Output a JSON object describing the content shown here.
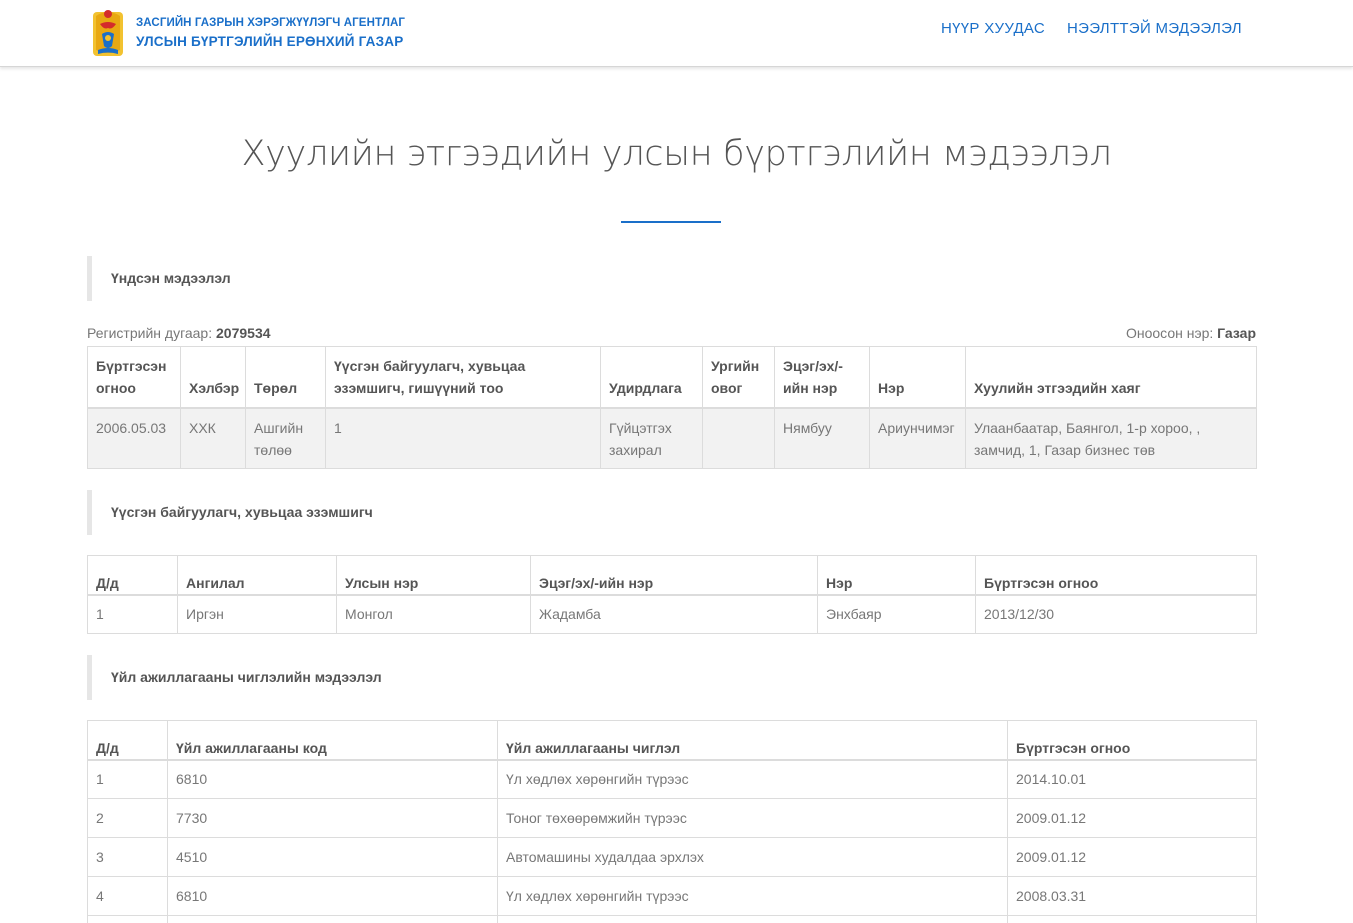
{
  "header": {
    "agency_line1": "ЗАСГИЙН ГАЗРЫН ХЭРЭГЖҮҮЛЭГЧ АГЕНТЛАГ",
    "agency_line2": "УЛСЫН БҮРТГЭЛИЙН ЕРӨНХИЙ ГАЗАР",
    "nav_home": "НҮҮР ХУУДАС",
    "nav_contact": "НЭЭЛТТЭЙ МЭДЭЭЛЭЛ",
    "accent": "#1a6fc9",
    "logo_icon": "state-emblem-icon"
  },
  "page_title": "Хуулийн этгээдийн улсын бүртгэлийн мэдээлэл",
  "basic": {
    "heading": "Үндсэн мэдээлэл",
    "reg_label": "Регистрийн дугаар:",
    "reg_value": "2079534",
    "name_label": "Оноосон нэр:",
    "name_value": "Газар",
    "columns": [
      "Бүртгэсэн огноо",
      "Хэлбэр",
      "Төрөл",
      "Үүсгэн байгуулагч, хувьцаа эзэмшигч, гишүүний тоо",
      "Удирдлага",
      "Ургийн овог",
      "Эцэг/эх/-ийн нэр",
      "Нэр",
      "Хуулийн этгээдийн хаяг"
    ],
    "row": [
      "2006.05.03",
      "ХХК",
      "Ашгийн төлөө",
      "1",
      "Гүйцэтгэх захирал",
      "",
      "Нямбуу",
      "Ариунчимэг",
      "Улаанбаатар, Баянгол, 1-р хороо, , замчид, 1, Газар бизнес төв"
    ]
  },
  "founders": {
    "heading": "Үүсгэн байгуулагч, хувьцаа эзэмшигч",
    "columns": [
      "Д/д",
      "Ангилал",
      "Улсын нэр",
      "Эцэг/эх/-ийн нэр",
      "Нэр",
      "Бүртгэсэн огноо"
    ],
    "rows": [
      [
        "1",
        "Иргэн",
        "Монгол",
        "Жадамба",
        "Энхбаяр",
        "2013/12/30"
      ]
    ]
  },
  "activities": {
    "heading": "Үйл ажиллагааны чиглэлийн мэдээлэл",
    "columns": [
      "Д/д",
      "Үйл ажиллагааны код",
      "Үйл ажиллагааны чиглэл",
      "Бүртгэсэн огноо"
    ],
    "rows": [
      [
        "1",
        "6810",
        "Үл хөдлөх хөрөнгийн түрээс",
        "2014.10.01"
      ],
      [
        "2",
        "7730",
        "Тоног төхөөрөмжийн түрээс",
        "2009.01.12"
      ],
      [
        "3",
        "4510",
        "Автомашины худалдаа эрхлэх",
        "2009.01.12"
      ],
      [
        "4",
        "6810",
        "Үл хөдлөх хөрөнгийн түрээс",
        "2008.03.31"
      ],
      [
        "",
        "",
        "",
        ""
      ]
    ]
  }
}
